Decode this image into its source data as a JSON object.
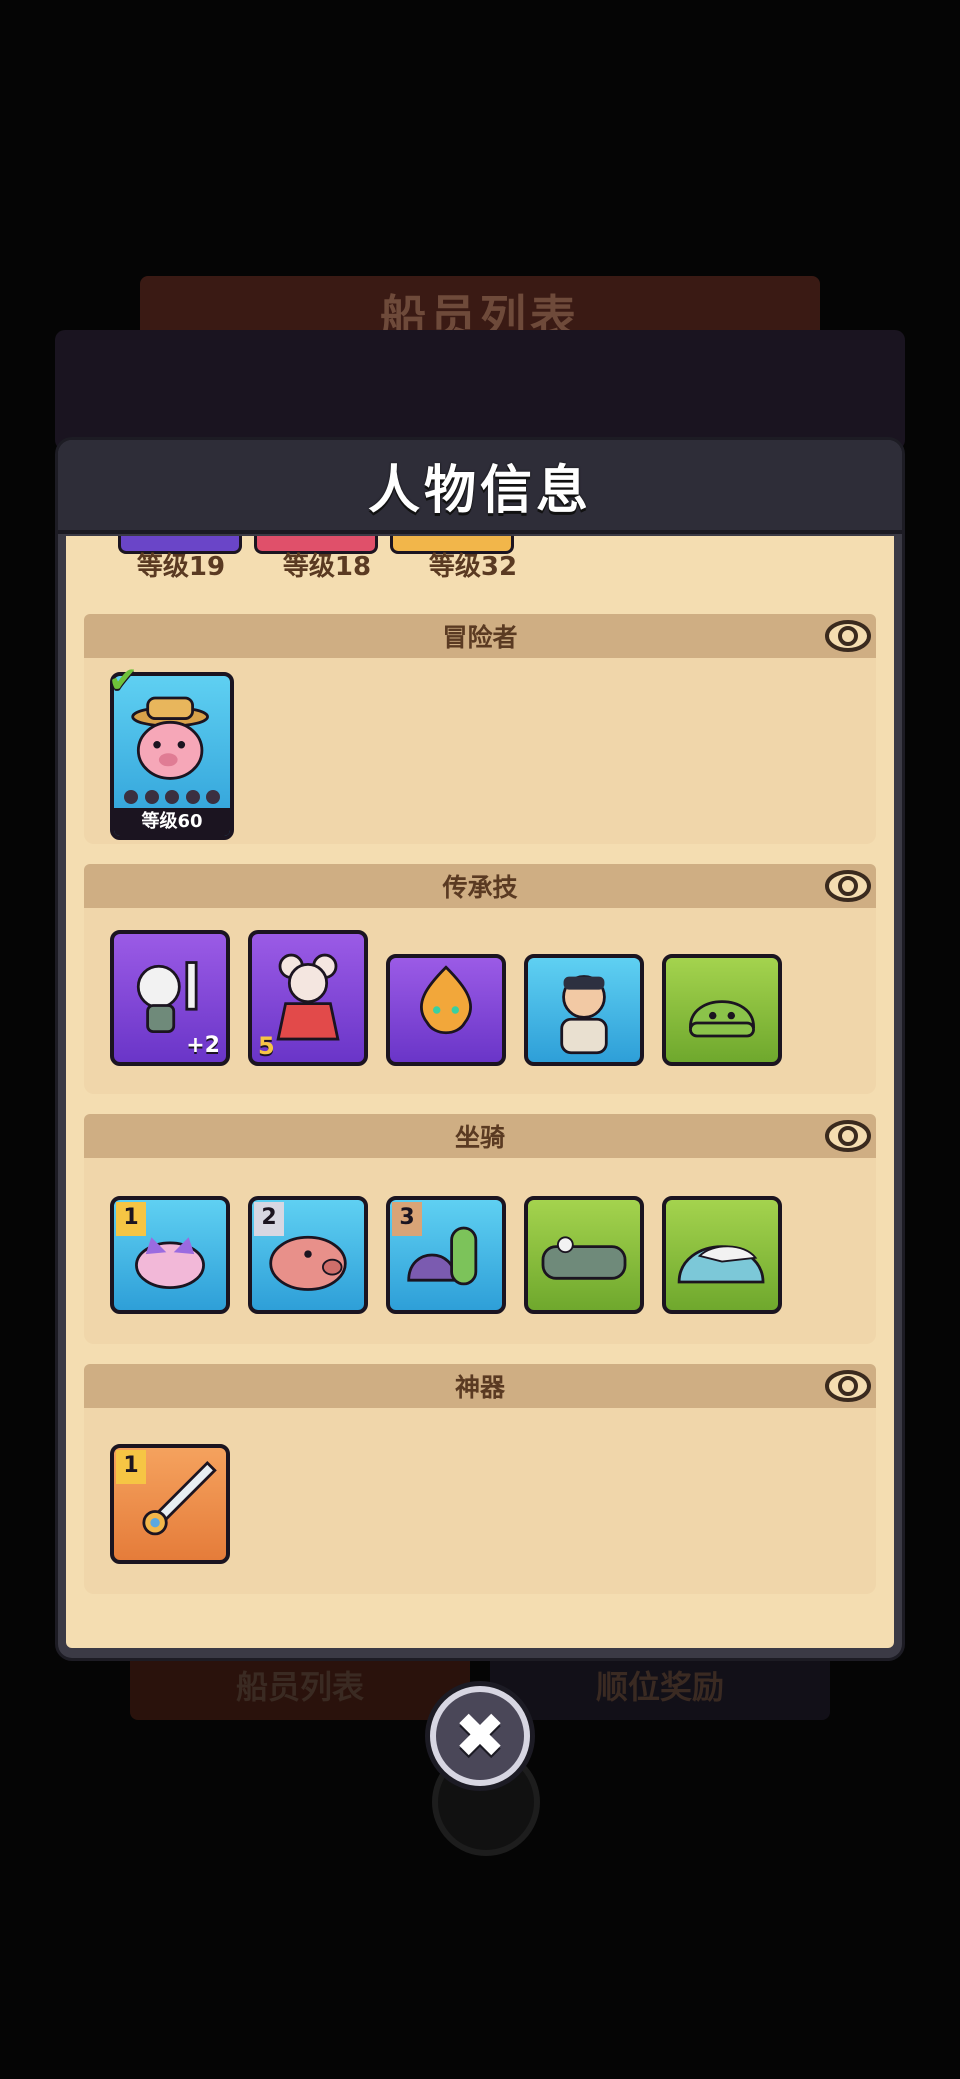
{
  "background": {
    "title": "船员列表",
    "tabs": [
      "船员列表",
      "顺位奖励"
    ]
  },
  "dialog": {
    "title": "人物信息",
    "top_levels": [
      "等级19",
      "等级18",
      "等级32"
    ],
    "sections": {
      "adventurer": {
        "title": "冒险者",
        "card_level": "等级60"
      },
      "legacy": {
        "title": "传承技",
        "badges": [
          "+2",
          "5"
        ]
      },
      "mount": {
        "title": "坐骑",
        "ranks": [
          "1",
          "2",
          "3"
        ]
      },
      "artifact": {
        "title": "神器",
        "rank": "1"
      }
    }
  },
  "icons": {
    "eye": "eye-icon",
    "close": "close-icon",
    "check": "check-icon"
  },
  "colors": {
    "panel": "#f4ddb1",
    "section_header": "#cfae83",
    "dialog_frame": "#3b3a45"
  }
}
